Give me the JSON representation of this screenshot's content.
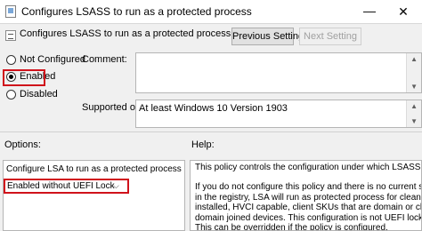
{
  "window": {
    "title": "Configures LSASS to run as a protected process",
    "minimize_glyph": "—",
    "close_glyph": "✕"
  },
  "header": {
    "policy_name": "Configures LSASS to run as a protected process",
    "previous_setting": "Previous Setting",
    "next_setting": "Next Setting"
  },
  "state": {
    "options": [
      {
        "label": "Not Configured",
        "checked": false
      },
      {
        "label": "Enabled",
        "checked": true
      },
      {
        "label": "Disabled",
        "checked": false
      }
    ]
  },
  "comment": {
    "label": "Comment:",
    "value": ""
  },
  "supported": {
    "label": "Supported on:",
    "value": "At least Windows 10 Version 1903"
  },
  "options_section": {
    "label": "Options:",
    "setting_label": "Configure LSA to run as a protected process",
    "selected_value": "Enabled without UEFI Lock"
  },
  "help": {
    "label": "Help:",
    "para1": "This policy controls the configuration under which LSASS is run.",
    "para2_lines": [
      "If you do not configure this policy and there is no current setting",
      "in the registry, LSA will run as protected process for clean",
      "installed, HVCI capable, client SKUs that are domain or cloud",
      "domain joined devices. This configuration is not UEFI locked.",
      "This can be overridden if the policy is configured."
    ]
  },
  "colors": {
    "highlight": "#d0121b",
    "dialog_bg": "#f0f0f0"
  }
}
